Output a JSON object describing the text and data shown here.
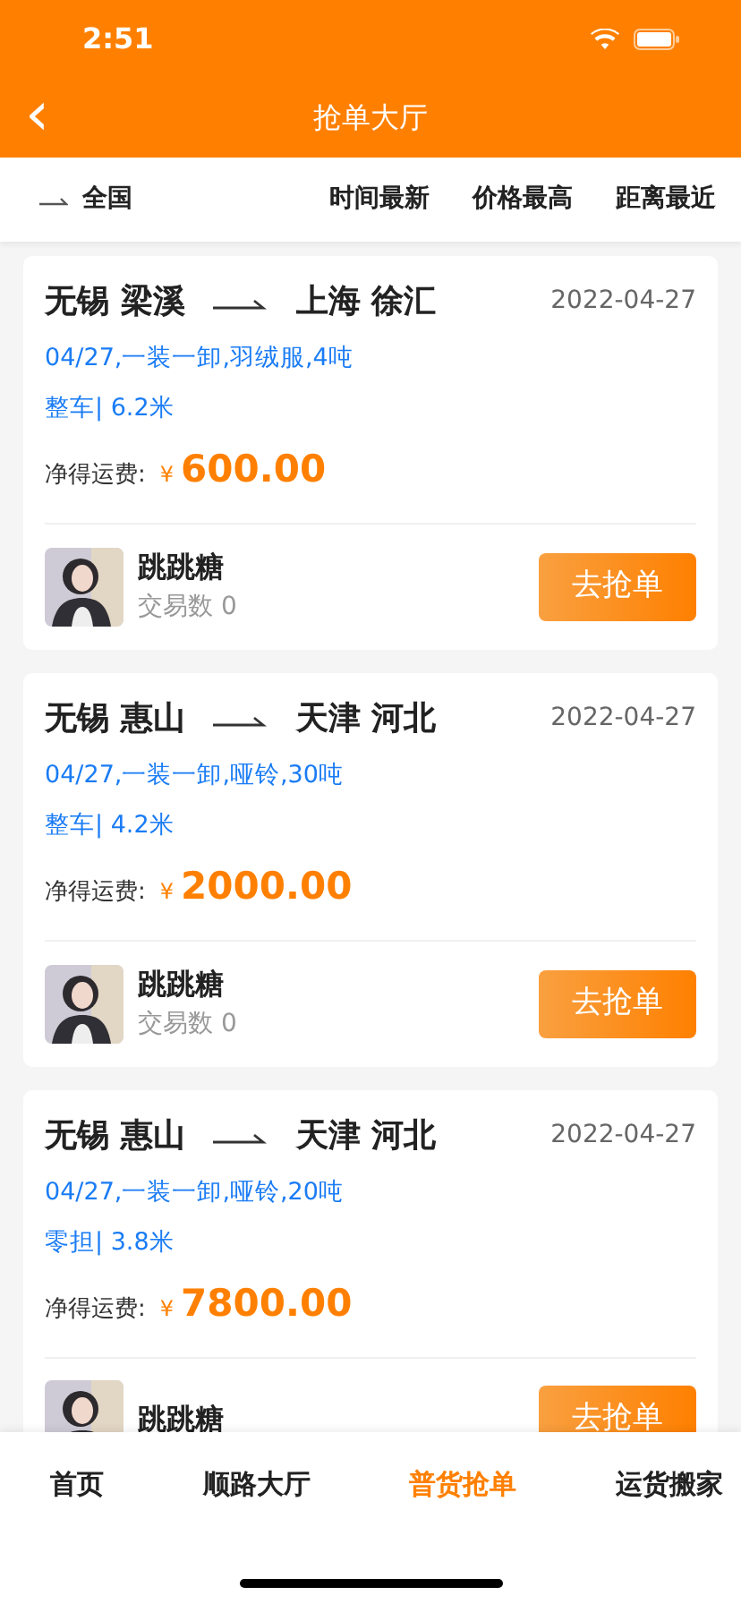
{
  "status_bar": {
    "time": "2:51"
  },
  "nav": {
    "back": "‹",
    "title": "抢单大厅"
  },
  "filter": {
    "region": "全国",
    "sorts": [
      "时间最新",
      "价格最高",
      "距离最近"
    ]
  },
  "orders": [
    {
      "from": "无锡 梁溪",
      "to": "上海 徐汇",
      "date": "2022-04-27",
      "info": "04/27,一装一卸,羽绒服,4吨",
      "truck": "整车| 6.2米",
      "price_label": "净得运费:",
      "currency": "¥",
      "amount": "600.00",
      "user": "跳跳糖",
      "trades": "交易数 0",
      "button": "去抢单"
    },
    {
      "from": "无锡 惠山",
      "to": "天津 河北",
      "date": "2022-04-27",
      "info": "04/27,一装一卸,哑铃,30吨",
      "truck": "整车| 4.2米",
      "price_label": "净得运费:",
      "currency": "¥",
      "amount": "2000.00",
      "user": "跳跳糖",
      "trades": "交易数 0",
      "button": "去抢单"
    },
    {
      "from": "无锡 惠山",
      "to": "天津 河北",
      "date": "2022-04-27",
      "info": "04/27,一装一卸,哑铃,20吨",
      "truck": "零担| 3.8米",
      "price_label": "净得运费:",
      "currency": "¥",
      "amount": "7800.00",
      "user": "跳跳糖",
      "button": "去抢单"
    }
  ],
  "tabs": [
    {
      "label": "首页",
      "selected": false
    },
    {
      "label": "顺路大厅",
      "selected": false
    },
    {
      "label": "普货抢单",
      "selected": true
    },
    {
      "label": "运货搬家",
      "selected": false
    }
  ]
}
